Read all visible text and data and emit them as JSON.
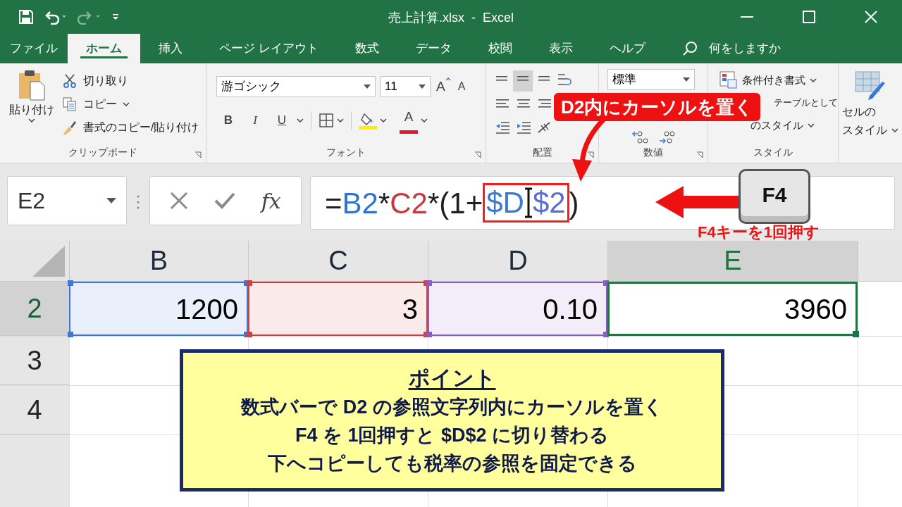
{
  "title_bar": {
    "title": "売上計算.xlsx  -  Excel",
    "quick_access": [
      {
        "kind": "save",
        "disabled": false
      },
      {
        "kind": "undo",
        "disabled": false
      },
      {
        "kind": "redo",
        "disabled": true
      },
      {
        "kind": "customize",
        "disabled": false
      }
    ]
  },
  "tabs": [
    {
      "label": "ファイル",
      "selected": false
    },
    {
      "label": "ホーム",
      "selected": true
    },
    {
      "label": "挿入",
      "selected": false
    },
    {
      "label": "ページ レイアウト",
      "selected": false
    },
    {
      "label": "数式",
      "selected": false
    },
    {
      "label": "データ",
      "selected": false
    },
    {
      "label": "校閲",
      "selected": false
    },
    {
      "label": "表示",
      "selected": false
    },
    {
      "label": "ヘルプ",
      "selected": false
    }
  ],
  "tell_me": {
    "placeholder": "何をしますか"
  },
  "ribbon": {
    "clipboard": {
      "paste": "貼り付け",
      "items": [
        {
          "kind": "cut",
          "label": "切り取り"
        },
        {
          "kind": "copy",
          "label": "コピー"
        },
        {
          "kind": "format_painter",
          "label": "書式のコピー/貼り付け"
        }
      ],
      "label": "クリップボード"
    },
    "font": {
      "name": "游ゴシック",
      "size": "11",
      "grow": "A",
      "shrink": "A",
      "styles": [
        "B",
        "I",
        "U"
      ],
      "font_color": "A",
      "label": "フォント"
    },
    "alignment": {
      "vertical": [
        {
          "selected": false
        },
        {
          "selected": true
        },
        {
          "selected": false
        }
      ],
      "label": "配置"
    },
    "number": {
      "format": "標準",
      "label": "数値"
    },
    "styles": {
      "items": [
        {
          "kind": "conditional",
          "label": "条件付き書式"
        },
        {
          "kind": "table",
          "label": "テーブルとして"
        },
        {
          "kind": "cell",
          "label": "のスタイル"
        }
      ],
      "label": "スタイル"
    },
    "cells": {
      "lines": [
        "セルの",
        "スタイル"
      ]
    }
  },
  "formula_bar": {
    "name_box": "E2",
    "fx": "fx",
    "tokens": [
      {
        "kind": "text",
        "text": "=",
        "color": "#1f1f1f",
        "highlighted": false
      },
      {
        "kind": "text",
        "text": "B2",
        "color": "#2f73d0",
        "highlighted": false
      },
      {
        "kind": "text",
        "text": "*",
        "color": "#1f1f1f",
        "highlighted": false
      },
      {
        "kind": "text",
        "text": "C2",
        "color": "#c8383c",
        "highlighted": false
      },
      {
        "kind": "text",
        "text": "*(1+",
        "color": "#1f1f1f",
        "highlighted": false
      },
      {
        "kind": "text",
        "text": "$D",
        "color": "#3a7ad4",
        "highlighted": true
      },
      {
        "kind": "cursor"
      },
      {
        "kind": "text",
        "text": "$2",
        "color": "#5a6fd0",
        "highlighted": true
      },
      {
        "kind": "text",
        "text": ")",
        "color": "#1f1f1f",
        "highlighted": false
      }
    ]
  },
  "grid": {
    "columns": [
      {
        "label": "B",
        "selected": false
      },
      {
        "label": "C",
        "selected": false
      },
      {
        "label": "D",
        "selected": false
      },
      {
        "label": "E",
        "selected": true
      }
    ],
    "rows": [
      {
        "header": "2",
        "selected": true,
        "cells": [
          {
            "value": "1200",
            "color": "#3a78d8",
            "selected": false
          },
          {
            "value": "3",
            "color": "#d0403f",
            "selected": false
          },
          {
            "value": "0.10",
            "color": "#8a5cc8",
            "selected": false
          },
          {
            "value": "3960",
            "selected": true
          }
        ]
      },
      {
        "header": "3",
        "selected": false
      },
      {
        "header": "4",
        "selected": false
      }
    ]
  },
  "point_box": {
    "title": "ポイント",
    "lines": [
      "数式バーで D2 の参照文字列内にカーソルを置く",
      "F4 を 1回押すと $D$2 に切り替わる",
      "下へコピーしても税率の参照を固定できる"
    ]
  },
  "annotations": {
    "callout": "D2内にカーソルを置く",
    "key": "F4",
    "key_caption": "F4キーを1回押す"
  }
}
